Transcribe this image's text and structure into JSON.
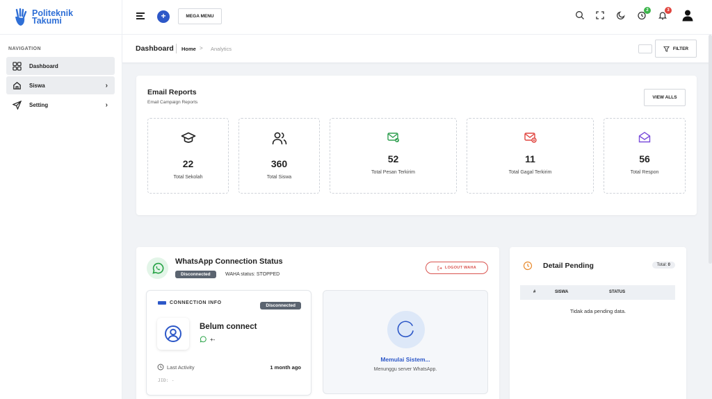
{
  "app": {
    "logo_line1": "Politeknik",
    "logo_line2": "Takumi",
    "brand_color": "#2f6fd6"
  },
  "sidebar": {
    "caption": "NAVIGATION",
    "items": [
      {
        "label": "Dashboard",
        "icon": "grid-icon"
      },
      {
        "label": "Siswa",
        "icon": "home-icon"
      },
      {
        "label": "Setting",
        "icon": "send-icon"
      }
    ]
  },
  "header": {
    "mega_menu_label": "MEGA MENU",
    "plus_label": "+",
    "badges": {
      "timer": "2",
      "bell": "3"
    },
    "badge_colors": {
      "timer": "#3bb54a",
      "bell": "#e0443e"
    }
  },
  "breadcrumb": {
    "title": "Dashboard",
    "home": "Home",
    "separator": ">",
    "current": "Analytics",
    "filter_label": "FILTER"
  },
  "email_reports": {
    "title": "Email Reports",
    "subtitle": "Email Campaign Reports",
    "view_all_label": "VIEW ALLS",
    "stats": [
      {
        "value": "22",
        "label": "Total Sekolah",
        "icon": "graduation-cap-icon",
        "color": "#222222"
      },
      {
        "value": "360",
        "label": "Total Siswa",
        "icon": "users-icon",
        "color": "#222222"
      },
      {
        "value": "52",
        "label": "Total Pesan Terkirim",
        "icon": "mail-check-icon",
        "color": "#2e9e4f"
      },
      {
        "value": "11",
        "label": "Total Gagal Terkirim",
        "icon": "mail-x-icon",
        "color": "#e0443e"
      },
      {
        "value": "56",
        "label": "Total Respon",
        "icon": "mail-open-icon",
        "color": "#7b4ddb"
      }
    ]
  },
  "whatsapp": {
    "title": "WhatsApp Connection Status",
    "status_pill": "Disconnected",
    "waha_status": "WAHA status: STOPPED",
    "logout_label": "LOGOUT WAHA",
    "connection": {
      "header": "CONNECTION INFO",
      "pill": "Disconnected",
      "name": "Belum connect",
      "phone": "+-",
      "last_activity_label": "Last Activity",
      "last_activity_value": "1 month ago",
      "jid": "JID: -"
    },
    "starting": {
      "title": "Memulai Sistem...",
      "subtitle": "Menunggu server WhatsApp."
    }
  },
  "pending": {
    "title": "Detail Pending",
    "total_label": "Total:",
    "total_value": "0",
    "columns": [
      "#",
      "SISWA",
      "STATUS"
    ],
    "empty_text": "Tidak ada pending data."
  }
}
